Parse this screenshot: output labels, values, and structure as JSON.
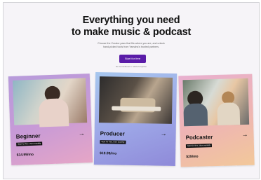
{
  "hero": {
    "title_line1": "Everything you need",
    "title_line2": "to make music & podcast",
    "subtitle_line1": "Choose the Creator pass that fits where you are, and unlock",
    "subtitle_line2": "hand-picked tools from Yamaha's trusted partners.",
    "cta_label": "Start for free",
    "note": "No commitment • cancel anytime"
  },
  "cards": [
    {
      "name": "Beginner",
      "badge": "Start for free, then monthly",
      "price": "$14.99/mo",
      "arrow": "→"
    },
    {
      "name": "Producer",
      "badge": "Start for free, then monthly",
      "price": "$19.99/mo",
      "arrow": "→"
    },
    {
      "name": "Podcaster",
      "badge": "Start for free, then monthly",
      "price": "$29/mo",
      "arrow": "→"
    }
  ],
  "colors": {
    "accent": "#5a1ca8"
  }
}
